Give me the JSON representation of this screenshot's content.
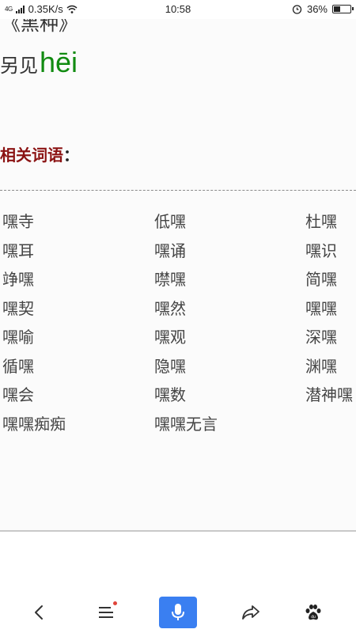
{
  "status_bar": {
    "signal": "4G",
    "speed": "0.35K/s",
    "time": "10:58",
    "battery": "36%"
  },
  "article": {
    "cut_title": "《黑种》",
    "see_also_label": "另见",
    "see_also_pinyin": "hēi",
    "related_heading": "相关词语",
    "related_colon": "：",
    "words": [
      [
        "嘿寺",
        "低嘿",
        "杜嘿"
      ],
      [
        "嘿耳",
        "嘿诵",
        "嘿识"
      ],
      [
        "竫嘿",
        "噤嘿",
        "简嘿"
      ],
      [
        "嘿契",
        "嘿然",
        "嘿嘿"
      ],
      [
        "嘿喻",
        "嘿观",
        "深嘿"
      ],
      [
        "循嘿",
        "隐嘿",
        "渊嘿"
      ],
      [
        "嘿会",
        "嘿数",
        "潜神嘿"
      ],
      [
        "嘿嘿痴痴",
        "嘿嘿无言",
        ""
      ]
    ]
  },
  "nav": {
    "back": "back-icon",
    "menu": "menu-icon",
    "voice": "microphone-icon",
    "share": "share-icon",
    "home": "baidu-paw-icon",
    "accent": "#3a7ff1"
  }
}
